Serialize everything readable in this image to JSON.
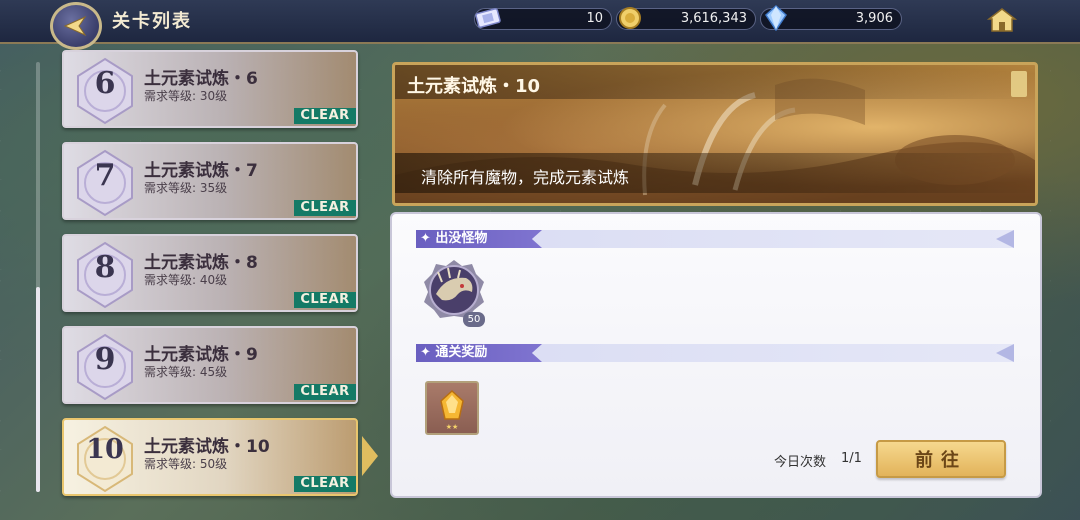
{
  "header": {
    "title": "关卡列表",
    "back_icon": "back-arrow-icon",
    "home_icon": "home-icon"
  },
  "resources": [
    {
      "name": "ticket",
      "icon": "ticket-icon",
      "value": "10"
    },
    {
      "name": "gold",
      "icon": "gold-coin-icon",
      "value": "3,616,343"
    },
    {
      "name": "diamond",
      "icon": "crystal-icon",
      "value": "3,906"
    }
  ],
  "stages": [
    {
      "number": "6",
      "name": "土元素试炼・6",
      "requirement": "需求等级: 30级",
      "status": "CLEAR"
    },
    {
      "number": "7",
      "name": "土元素试炼・7",
      "requirement": "需求等级: 35级",
      "status": "CLEAR"
    },
    {
      "number": "8",
      "name": "土元素试炼・8",
      "requirement": "需求等级: 40级",
      "status": "CLEAR"
    },
    {
      "number": "9",
      "name": "土元素试炼・9",
      "requirement": "需求等级: 45级",
      "status": "CLEAR"
    },
    {
      "number": "10",
      "name": "土元素试炼・10",
      "requirement": "需求等级: 50级",
      "status": "CLEAR",
      "selected": true
    }
  ],
  "detail": {
    "title": "土元素试炼・10",
    "description": "清除所有魔物，完成元素试炼",
    "monsters_label": "出没怪物",
    "monster": {
      "icon": "dragon-monster-icon",
      "level": "50"
    },
    "rewards_label": "通关奖励",
    "reward": {
      "icon": "amber-gem-icon"
    },
    "daily_label": "今日次数",
    "daily_value": "1/1",
    "go_button": "前往"
  },
  "colors": {
    "clear_badge": "#147a66",
    "section_tab": "#6a5fc0",
    "go_button": "#e2b35a",
    "selected_border": "#e9c66e"
  }
}
